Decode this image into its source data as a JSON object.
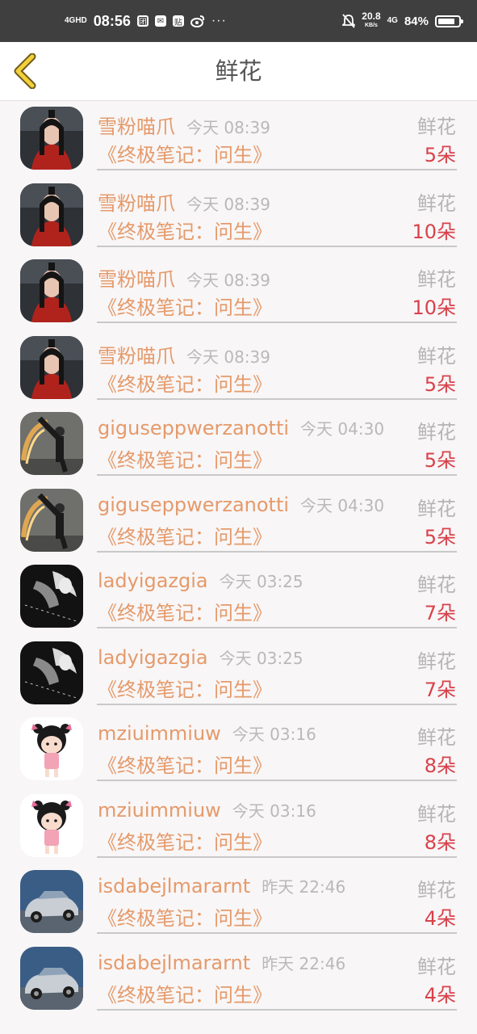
{
  "status_bar": {
    "network": "4GHD",
    "time": "08:56",
    "notif_icons": [
      "团",
      "✉",
      "贴",
      "微博"
    ],
    "more": "···",
    "speed_value": "20.8",
    "speed_unit": "KB/s",
    "network2": "4G",
    "battery_pct": "84%",
    "battery_level": 0.84
  },
  "header": {
    "title": "鲜花"
  },
  "items": [
    {
      "avatar": "woman-red-scarf",
      "user": "雪粉喵爪",
      "time": "今天 08:39",
      "gift": "鲜花",
      "book": "《终极笔记：问生》",
      "count": "5朵"
    },
    {
      "avatar": "woman-red-scarf",
      "user": "雪粉喵爪",
      "time": "今天 08:39",
      "gift": "鲜花",
      "book": "《终极笔记：问生》",
      "count": "10朵"
    },
    {
      "avatar": "woman-red-scarf",
      "user": "雪粉喵爪",
      "time": "今天 08:39",
      "gift": "鲜花",
      "book": "《终极笔记：问生》",
      "count": "10朵"
    },
    {
      "avatar": "woman-red-scarf",
      "user": "雪粉喵爪",
      "time": "今天 08:39",
      "gift": "鲜花",
      "book": "《终极笔记：问生》",
      "count": "5朵"
    },
    {
      "avatar": "kicking-man",
      "user": "giguseppwerzanotti",
      "time": "今天 04:30",
      "gift": "鲜花",
      "book": "《终极笔记：问生》",
      "count": "5朵"
    },
    {
      "avatar": "kicking-man",
      "user": "giguseppwerzanotti",
      "time": "今天 04:30",
      "gift": "鲜花",
      "book": "《终极笔记：问生》",
      "count": "5朵"
    },
    {
      "avatar": "dark-photo",
      "user": "ladyigazgia",
      "time": "今天 03:25",
      "gift": "鲜花",
      "book": "《终极笔记：问生》",
      "count": "7朵"
    },
    {
      "avatar": "dark-photo",
      "user": "ladyigazgia",
      "time": "今天 03:25",
      "gift": "鲜花",
      "book": "《终极笔记：问生》",
      "count": "7朵"
    },
    {
      "avatar": "cartoon-girl",
      "user": "mziuimmiuw",
      "time": "今天 03:16",
      "gift": "鲜花",
      "book": "《终极笔记：问生》",
      "count": "8朵"
    },
    {
      "avatar": "cartoon-girl",
      "user": "mziuimmiuw",
      "time": "今天 03:16",
      "gift": "鲜花",
      "book": "《终极笔记：问生》",
      "count": "8朵"
    },
    {
      "avatar": "silver-car",
      "user": "isdabejlmararnt",
      "time": "昨天 22:46",
      "gift": "鲜花",
      "book": "《终极笔记：问生》",
      "count": "4朵"
    },
    {
      "avatar": "silver-car",
      "user": "isdabejlmararnt",
      "time": "昨天 22:46",
      "gift": "鲜花",
      "book": "《终极笔记：问生》",
      "count": "4朵"
    }
  ]
}
